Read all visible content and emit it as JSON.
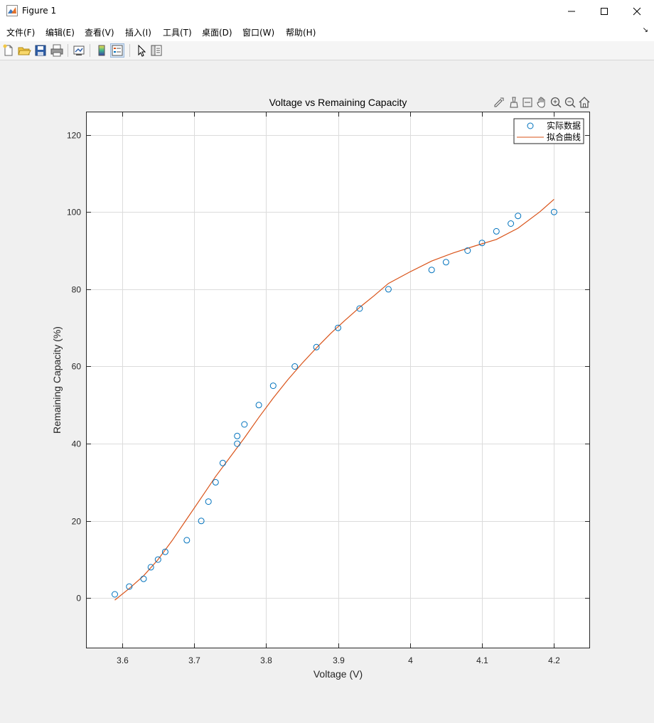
{
  "window": {
    "title": "Figure 1"
  },
  "menu": [
    "文件(F)",
    "编辑(E)",
    "查看(V)",
    "插入(I)",
    "工具(T)",
    "桌面(D)",
    "窗口(W)",
    "帮助(H)"
  ],
  "toolbar_icons": [
    "new-figure-icon",
    "open-file-icon",
    "save-icon",
    "print-icon",
    "link-plot-icon",
    "insert-colorbar-icon",
    "insert-legend-icon",
    "edit-plot-pointer-icon",
    "property-inspector-icon"
  ],
  "axes_toolbar_icons": [
    "export-icon",
    "brush-icon",
    "datatip-icon",
    "pan-icon",
    "zoom-in-icon",
    "zoom-out-icon",
    "home-icon"
  ],
  "colors": {
    "scatter": "#0072bd",
    "fit_line": "#d95319",
    "grid": "#dcdcdc",
    "axes_bg": "#ffffff"
  },
  "chart_data": {
    "type": "scatter",
    "title": "Voltage vs Remaining Capacity",
    "xlabel": "Voltage (V)",
    "ylabel": "Remaining Capacity (%)",
    "xlim": [
      3.55,
      4.25
    ],
    "ylim": [
      -13,
      126
    ],
    "xticks": [
      3.6,
      3.7,
      3.8,
      3.9,
      4.0,
      4.1,
      4.2
    ],
    "xtick_labels": [
      "3.6",
      "3.7",
      "3.8",
      "3.9",
      "4",
      "4.1",
      "4.2"
    ],
    "yticks": [
      0,
      20,
      40,
      60,
      80,
      100,
      120
    ],
    "ytick_labels": [
      "0",
      "20",
      "40",
      "60",
      "80",
      "100",
      "120"
    ],
    "grid": true,
    "legend_position": "top-right",
    "series": [
      {
        "name": "实际数据",
        "kind": "scatter",
        "marker": "circle",
        "x": [
          3.59,
          3.61,
          3.63,
          3.64,
          3.65,
          3.66,
          3.69,
          3.71,
          3.72,
          3.73,
          3.74,
          3.76,
          3.76,
          3.77,
          3.79,
          3.81,
          3.84,
          3.87,
          3.9,
          3.93,
          3.97,
          4.03,
          4.05,
          4.08,
          4.1,
          4.12,
          4.14,
          4.15,
          4.2
        ],
        "y": [
          1,
          3,
          5,
          8,
          10,
          12,
          15,
          20,
          25,
          30,
          35,
          40,
          42,
          45,
          50,
          55,
          60,
          65,
          70,
          75,
          80,
          85,
          87,
          90,
          92,
          95,
          97,
          99,
          100
        ]
      },
      {
        "name": "拟合曲线",
        "kind": "line",
        "x": [
          3.59,
          3.61,
          3.63,
          3.65,
          3.67,
          3.69,
          3.71,
          3.73,
          3.75,
          3.77,
          3.79,
          3.81,
          3.83,
          3.85,
          3.87,
          3.89,
          3.91,
          3.93,
          3.95,
          3.97,
          4.0,
          4.03,
          4.06,
          4.09,
          4.12,
          4.15,
          4.18,
          4.2
        ],
        "y": [
          -0.5,
          2.5,
          5.8,
          10,
          15,
          20.5,
          26,
          31.5,
          36.5,
          41.5,
          46.8,
          51.8,
          56.5,
          60.8,
          64.8,
          68.6,
          72,
          75.3,
          78.3,
          81.5,
          84.5,
          87.3,
          89.4,
          91.2,
          92.9,
          95.8,
          100,
          103.3
        ]
      }
    ]
  }
}
